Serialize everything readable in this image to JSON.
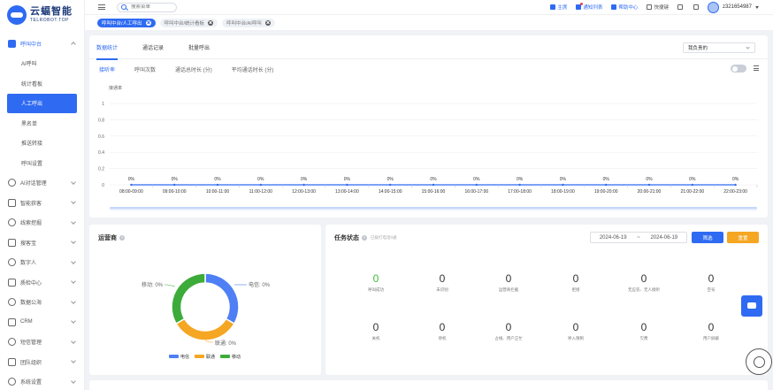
{
  "brand": {
    "name_cn": "云蝠智能",
    "name_en": "TELROBOT.TOP"
  },
  "sidebar": {
    "items": [
      {
        "label": "呼叫中台",
        "icon": "monitor-icon",
        "open": true
      },
      {
        "label": "AI呼叫",
        "sub": true
      },
      {
        "label": "统计看板",
        "sub": true
      },
      {
        "label": "人工呼出",
        "sub": true,
        "active": true
      },
      {
        "label": "黑名单",
        "sub": true
      },
      {
        "label": "推送转接",
        "sub": true
      },
      {
        "label": "呼叫设置",
        "sub": true
      },
      {
        "label": "AI对话管理",
        "icon": "chat-icon"
      },
      {
        "label": "智能获客",
        "icon": "search-user-icon"
      },
      {
        "label": "线索挖掘",
        "icon": "mining-icon"
      },
      {
        "label": "搜客宝",
        "icon": "search-icon"
      },
      {
        "label": "数字人",
        "icon": "person-icon"
      },
      {
        "label": "质检中心",
        "icon": "inspect-icon"
      },
      {
        "label": "数据公海",
        "icon": "database-icon"
      },
      {
        "label": "CRM",
        "icon": "crm-icon"
      },
      {
        "label": "短信管理",
        "icon": "sms-icon"
      },
      {
        "label": "团队组织",
        "icon": "team-icon"
      },
      {
        "label": "系统设置",
        "icon": "settings-icon"
      }
    ]
  },
  "header": {
    "search_placeholder": "搜索菜单",
    "tools": [
      {
        "label": "主席",
        "name": "refresh-tool"
      },
      {
        "label": "通知列表",
        "name": "notification-tool"
      },
      {
        "label": "帮助中心",
        "name": "help-tool"
      },
      {
        "label": "快捷键",
        "name": "shortcut-tool"
      }
    ],
    "username": "z321654987"
  },
  "page_tabs": [
    {
      "label": "呼叫中台/人工呼出",
      "active": true
    },
    {
      "label": "呼叫中台/统计看板",
      "active": false
    },
    {
      "label": "呼叫中台/AI呼叫",
      "active": false
    }
  ],
  "main": {
    "subtabs": [
      "数据统计",
      "通话记录",
      "批量呼出"
    ],
    "responsible_select": "我负责的",
    "metric_tabs": [
      "接听率",
      "呼叫次数",
      "通话总时长 (分)",
      "平均通话时长 (分)"
    ]
  },
  "chart_data": {
    "type": "line",
    "ylabel": "接通率",
    "ylim": [
      0,
      1
    ],
    "yticks": [
      "0",
      "0.2",
      "0.4",
      "0.6",
      "0.8",
      "1"
    ],
    "categories": [
      "08:00-09:00",
      "09:00-10:00",
      "10:00-11:00",
      "11:00-12:00",
      "12:00-13:00",
      "13:00-14:00",
      "14:00-15:00",
      "15:00-16:00",
      "16:00-17:00",
      "17:00-18:00",
      "18:00-19:00",
      "19:00-20:00",
      "20:00-21:00",
      "21:00-22:00",
      "22:00-23:00"
    ],
    "values": [
      0,
      0,
      0,
      0,
      0,
      0,
      0,
      0,
      0,
      0,
      0,
      0,
      0,
      0,
      0
    ],
    "data_labels": [
      "0%",
      "0%",
      "0%",
      "0%",
      "0%",
      "0%",
      "0%",
      "0%",
      "0%",
      "0%",
      "0%",
      "0%",
      "0%",
      "0%",
      "0%"
    ],
    "grid": true,
    "color": "#2f6bf2"
  },
  "operator": {
    "title": "运营商",
    "labels": {
      "mobile": "移动: 0%",
      "telecom": "电信: 0%",
      "unicom": "联通: 0%"
    },
    "legend": [
      {
        "label": "电信",
        "color": "#4e7ff5"
      },
      {
        "label": "联通",
        "color": "#f5a623"
      },
      {
        "label": "移动",
        "color": "#3dab3a"
      }
    ],
    "slices": [
      {
        "name": "电信",
        "value": 1,
        "color": "#4e7ff5"
      },
      {
        "name": "联通",
        "value": 1,
        "color": "#f5a623"
      },
      {
        "name": "移动",
        "value": 1,
        "color": "#3dab3a"
      }
    ]
  },
  "task": {
    "title": "任务状态",
    "subtitle": "已拨打电话0通",
    "date_start": "2024-06-19",
    "date_sep": "~",
    "date_end": "2024-06-19",
    "filter_label": "筛选",
    "reset_label": "重置",
    "stats": [
      {
        "value": "0",
        "label": "呼叫成功",
        "highlight": true
      },
      {
        "value": "0",
        "label": "未识别"
      },
      {
        "value": "0",
        "label": "运营商拦截"
      },
      {
        "value": "0",
        "label": "拒接"
      },
      {
        "value": "0",
        "label": "无应答、无人接听"
      },
      {
        "value": "0",
        "label": "空号"
      },
      {
        "value": "0",
        "label": "关机"
      },
      {
        "value": "0",
        "label": "停机"
      },
      {
        "value": "0",
        "label": "占线、用户正忙"
      },
      {
        "value": "0",
        "label": "呼入限制"
      },
      {
        "value": "0",
        "label": "欠费"
      },
      {
        "value": "0",
        "label": "用户屏蔽"
      }
    ]
  }
}
